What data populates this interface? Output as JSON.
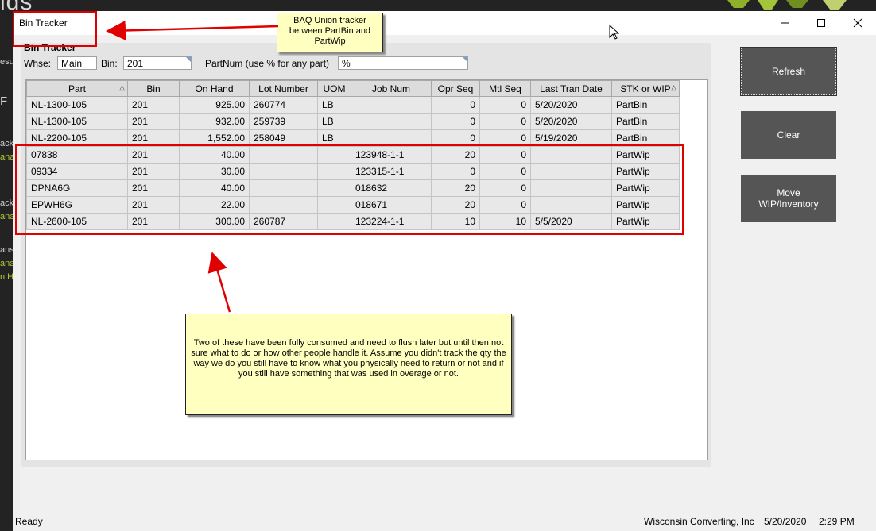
{
  "background": {
    "logo_text": "ids",
    "left_labels": [
      {
        "text": "esu",
        "accent": false
      },
      {
        "text": "F",
        "accent": false
      },
      {
        "text": "ack",
        "accent": false
      },
      {
        "text": "ana",
        "accent": true
      },
      {
        "text": "ack",
        "accent": false
      },
      {
        "text": "ana",
        "accent": true
      },
      {
        "text": "ans",
        "accent": false
      },
      {
        "text": "ana",
        "accent": true
      },
      {
        "text": "n Hi",
        "accent": true
      }
    ]
  },
  "window": {
    "title": "Bin Tracker",
    "panel_title": "Bin Tracker"
  },
  "filters": {
    "whse_label": "Whse:",
    "whse_value": "Main",
    "bin_label": "Bin:",
    "bin_value": "201",
    "partnum_label": "PartNum (use % for any part)",
    "partnum_value": "%"
  },
  "grid": {
    "columns": [
      "Part",
      "Bin",
      "On Hand",
      "Lot Number",
      "UOM",
      "Job Num",
      "Opr Seq",
      "Mtl Seq",
      "Last Tran Date",
      "STK or WIP"
    ],
    "rows": [
      [
        "NL-1300-105",
        "201",
        "925.00",
        "260774",
        "LB",
        "",
        "0",
        "0",
        "5/20/2020",
        "PartBin"
      ],
      [
        "NL-1300-105",
        "201",
        "932.00",
        "259739",
        "LB",
        "",
        "0",
        "0",
        "5/20/2020",
        "PartBin"
      ],
      [
        "NL-2200-105",
        "201",
        "1,552.00",
        "258049",
        "LB",
        "",
        "0",
        "0",
        "5/19/2020",
        "PartBin"
      ],
      [
        "07838",
        "201",
        "40.00",
        "",
        "",
        "123948-1-1",
        "20",
        "0",
        "",
        "PartWip"
      ],
      [
        "09334",
        "201",
        "30.00",
        "",
        "",
        "123315-1-1",
        "0",
        "0",
        "",
        "PartWip"
      ],
      [
        "DPNA6G",
        "201",
        "40.00",
        "",
        "",
        "018632",
        "20",
        "0",
        "",
        "PartWip"
      ],
      [
        "EPWH6G",
        "201",
        "22.00",
        "",
        "",
        "018671",
        "20",
        "0",
        "",
        "PartWip"
      ],
      [
        "NL-2600-105",
        "201",
        "300.00",
        "260787",
        "",
        "123224-1-1",
        "10",
        "10",
        "5/5/2020",
        "PartWip"
      ]
    ]
  },
  "buttons": {
    "refresh": "Refresh",
    "clear": "Clear",
    "move": "Move\nWIP/Inventory"
  },
  "status": {
    "left": "Ready",
    "company": "Wisconsin Converting, Inc",
    "date": "5/20/2020",
    "time": "2:29 PM"
  },
  "annotations": {
    "top_callout": "BAQ Union tracker between PartBin and PartWip",
    "main_callout": "Two of these have been fully consumed and need to flush later but until then not sure what to do or how other people handle it. Assume you didn't track the qty the way we do you still have to know what you physically need to return or not and if you still have something that was used in overage or not."
  },
  "colors": {
    "annotation_red": "#e00000",
    "callout_fill": "#ffffc0",
    "button_fill": "#555555",
    "accent_green": "#b4c832"
  }
}
